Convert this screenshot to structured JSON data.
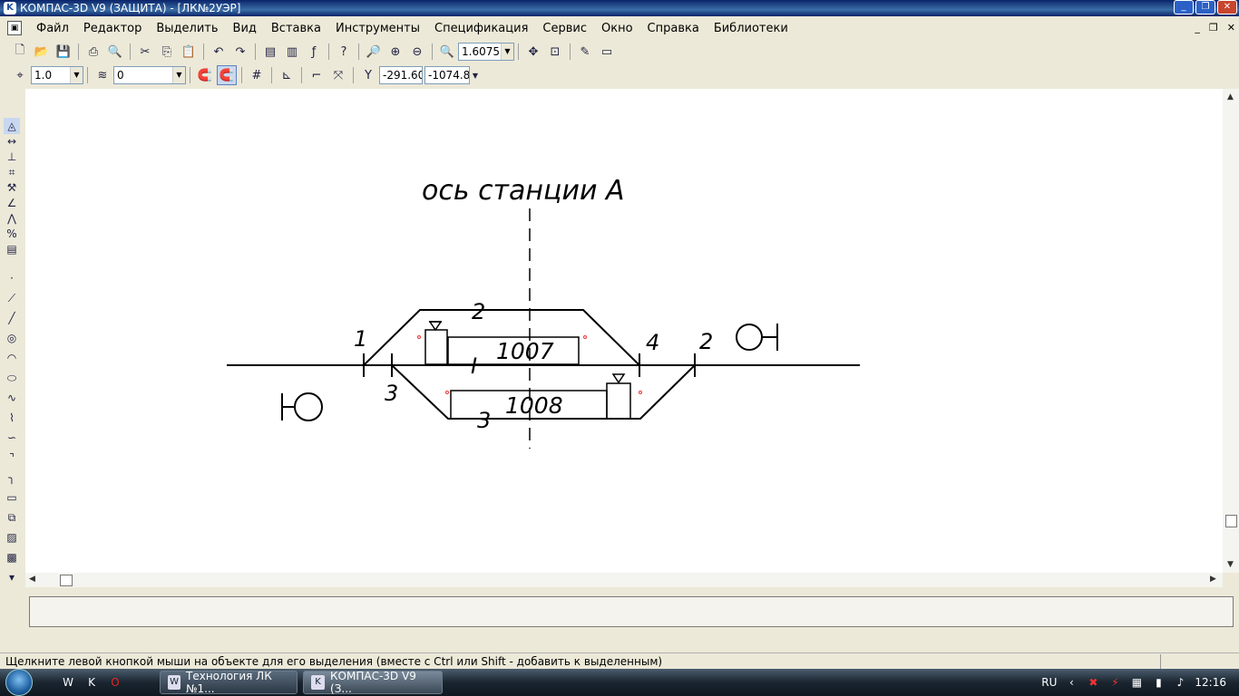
{
  "window": {
    "title": "КОМПАС-3D V9 (ЗАЩИТА) - [ЛК№2УЭР]",
    "minimize_icon": "minimize-icon",
    "maximize_icon": "restore-icon",
    "close_icon": "close-icon",
    "close_label": "✕"
  },
  "menu": {
    "items": [
      "Файл",
      "Редактор",
      "Выделить",
      "Вид",
      "Вставка",
      "Инструменты",
      "Спецификация",
      "Сервис",
      "Окно",
      "Справка",
      "Библиотеки"
    ]
  },
  "toolbar": {
    "zoom_value": "1.6075",
    "line_scale": "1.0",
    "layer_value": "0",
    "coord_x": "-291.60",
    "coord_y": "-1074.8"
  },
  "drawing": {
    "axis_title": "ось станции А",
    "labels": {
      "switch1": "1",
      "switch2_top": "2",
      "switch4": "4",
      "switch2_right": "2",
      "switch3": "3",
      "track3": "3",
      "track1": "I",
      "track2": "2",
      "signal_left_code": "1007",
      "signal_right_code": "1008"
    }
  },
  "status": {
    "message": "Щелкните левой кнопкой мыши на объекте для его выделения (вместе с Ctrl или Shift - добавить к выделенным)"
  },
  "taskbar": {
    "tasks": [
      {
        "label": "Технология ЛК №1...",
        "icon": "word-doc-icon"
      },
      {
        "label": "КОМПАС-3D V9 (З...",
        "icon": "kompas-icon"
      }
    ],
    "language": "RU",
    "clock": "12:16"
  }
}
